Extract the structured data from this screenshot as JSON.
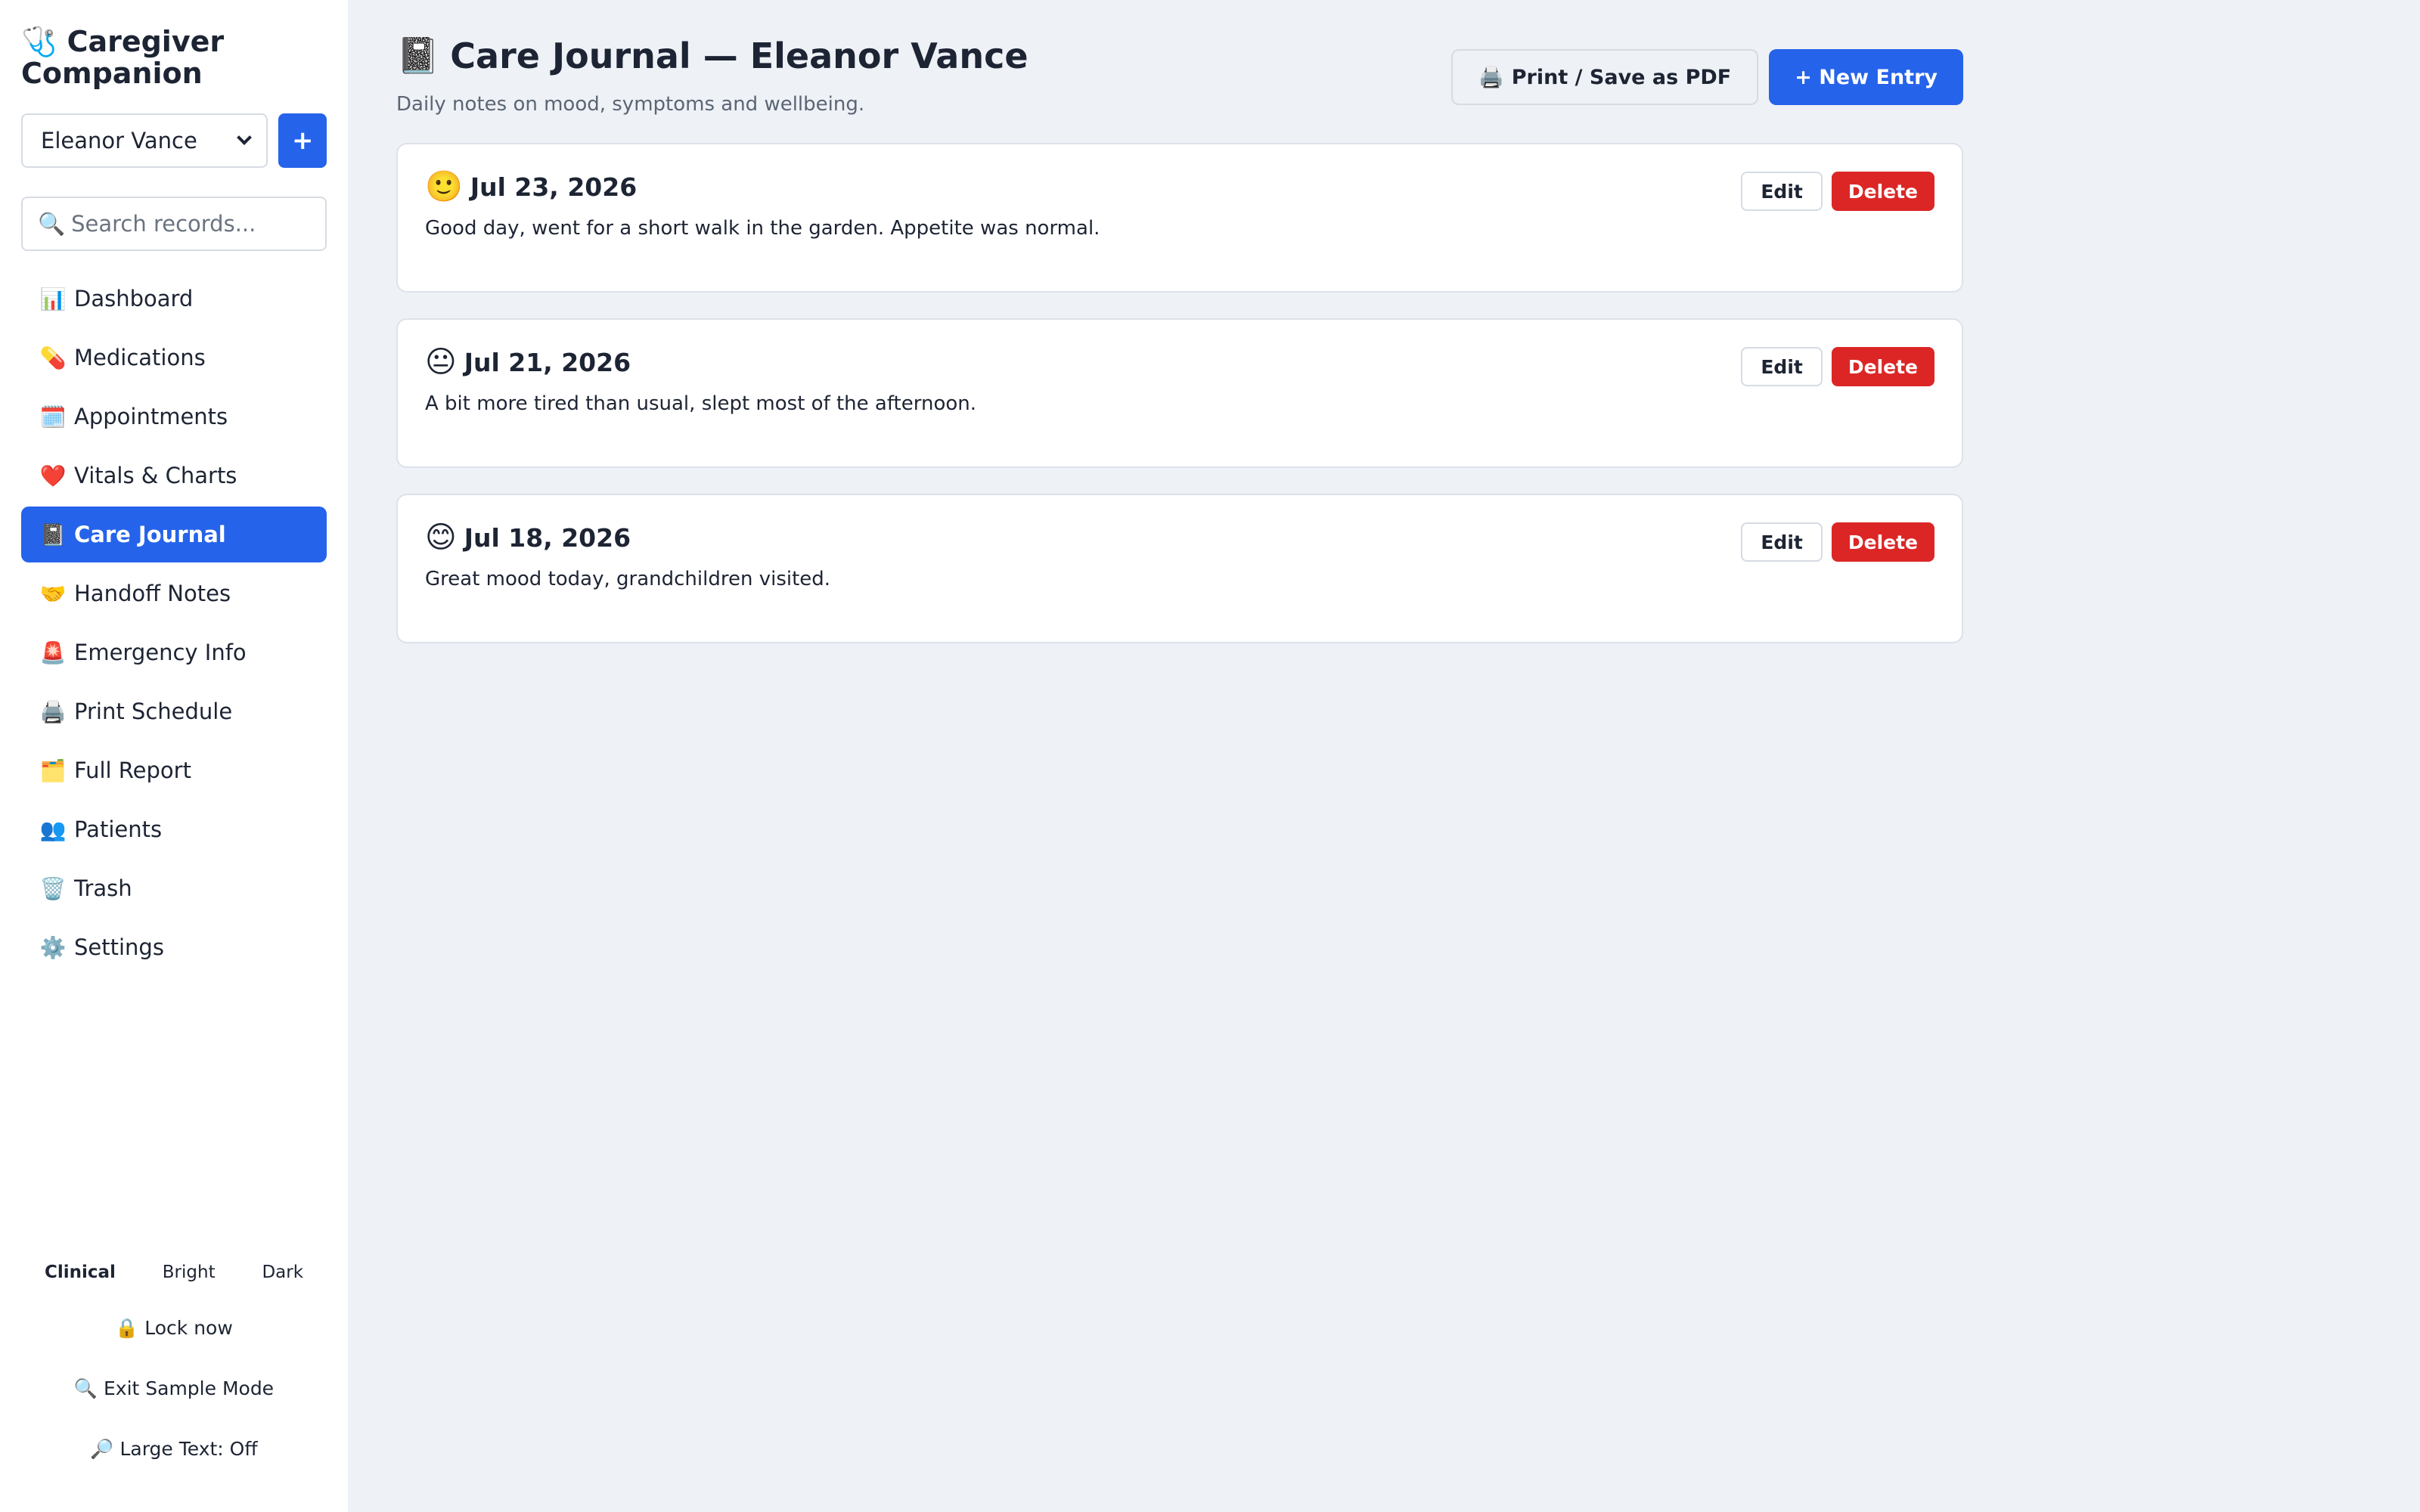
{
  "app": {
    "brand_icon": "🩺",
    "brand_name": "Caregiver Companion"
  },
  "sidebar": {
    "patient_selected": "Eleanor Vance",
    "add_patient_label": "+",
    "search_icon": "🔍",
    "search_placeholder": "Search records...",
    "items": [
      {
        "icon": "📊",
        "label": "Dashboard"
      },
      {
        "icon": "💊",
        "label": "Medications"
      },
      {
        "icon": "🗓️",
        "label": "Appointments"
      },
      {
        "icon": "❤️",
        "label": "Vitals & Charts"
      },
      {
        "icon": "📓",
        "label": "Care Journal"
      },
      {
        "icon": "🤝",
        "label": "Handoff Notes"
      },
      {
        "icon": "🚨",
        "label": "Emergency Info"
      },
      {
        "icon": "🖨️",
        "label": "Print Schedule"
      },
      {
        "icon": "🗂️",
        "label": "Full Report"
      },
      {
        "icon": "👥",
        "label": "Patients"
      },
      {
        "icon": "🗑️",
        "label": "Trash"
      },
      {
        "icon": "⚙️",
        "label": "Settings"
      }
    ],
    "active_item": "Care Journal",
    "themes": [
      "Clinical",
      "Bright",
      "Dark"
    ],
    "selected_theme": "Clinical",
    "lock_label": "🔒 Lock now",
    "sample_mode_label": "🔍 Exit Sample Mode",
    "large_text_label": "🔎 Large Text: Off"
  },
  "header": {
    "icon": "📓",
    "title": "Care Journal — Eleanor Vance",
    "subtitle": "Daily notes on mood, symptoms and wellbeing.",
    "print_icon": "🖨️",
    "print_label": "Print / Save as PDF",
    "new_entry_label": "+ New Entry"
  },
  "entries": [
    {
      "mood": "🙂",
      "date": "Jul 23, 2026",
      "note": "Good day, went for a short walk in the garden. Appetite was normal.",
      "edit_label": "Edit",
      "delete_label": "Delete"
    },
    {
      "mood": "😐",
      "date": "Jul 21, 2026",
      "note": "A bit more tired than usual, slept most of the afternoon.",
      "edit_label": "Edit",
      "delete_label": "Delete"
    },
    {
      "mood": "😊",
      "date": "Jul 18, 2026",
      "note": "Great mood today, grandchildren visited.",
      "edit_label": "Edit",
      "delete_label": "Delete"
    }
  ],
  "colors": {
    "accent": "#2563eb",
    "danger": "#dc2626",
    "background": "#eef1f6",
    "surface": "#ffffff"
  }
}
